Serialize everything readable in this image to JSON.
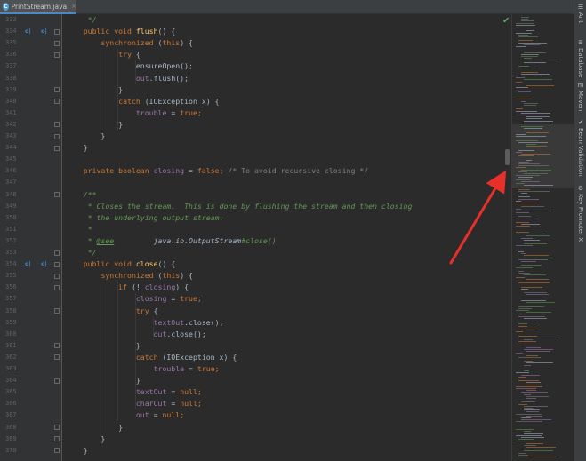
{
  "tab": {
    "icon": "C",
    "label": "PrintStream.java",
    "close": "×"
  },
  "editor": {
    "lines": [
      {
        "n": "333",
        "segs": [
          {
            "t": "     */",
            "c": "dc"
          }
        ]
      },
      {
        "n": "334",
        "m": [
          "o|",
          "o|"
        ],
        "segs": [
          {
            "t": "    ",
            "c": ""
          },
          {
            "t": "public void ",
            "c": "k"
          },
          {
            "t": "flush",
            "c": "f"
          },
          {
            "t": "() {",
            "c": ""
          }
        ]
      },
      {
        "n": "335",
        "segs": [
          {
            "t": "        ",
            "c": ""
          },
          {
            "t": "synchronized ",
            "c": "k"
          },
          {
            "t": "(",
            "c": ""
          },
          {
            "t": "this",
            "c": "k"
          },
          {
            "t": ") {",
            "c": ""
          }
        ]
      },
      {
        "n": "336",
        "segs": [
          {
            "t": "            ",
            "c": ""
          },
          {
            "t": "try ",
            "c": "k"
          },
          {
            "t": "{",
            "c": ""
          }
        ]
      },
      {
        "n": "337",
        "segs": [
          {
            "t": "                ensureOpen();",
            "c": ""
          }
        ]
      },
      {
        "n": "338",
        "segs": [
          {
            "t": "                ",
            "c": ""
          },
          {
            "t": "out",
            "c": "fld"
          },
          {
            "t": ".flush();",
            "c": ""
          }
        ]
      },
      {
        "n": "339",
        "segs": [
          {
            "t": "            }",
            "c": ""
          }
        ]
      },
      {
        "n": "340",
        "segs": [
          {
            "t": "            ",
            "c": ""
          },
          {
            "t": "catch ",
            "c": "k"
          },
          {
            "t": "(IOException x) {",
            "c": ""
          }
        ]
      },
      {
        "n": "341",
        "segs": [
          {
            "t": "                ",
            "c": ""
          },
          {
            "t": "trouble",
            "c": "fld"
          },
          {
            "t": " = ",
            "c": ""
          },
          {
            "t": "true",
            "c": "k"
          },
          {
            "t": ";",
            "c": "k"
          }
        ]
      },
      {
        "n": "342",
        "segs": [
          {
            "t": "            }",
            "c": ""
          }
        ]
      },
      {
        "n": "343",
        "segs": [
          {
            "t": "        }",
            "c": ""
          }
        ]
      },
      {
        "n": "344",
        "segs": [
          {
            "t": "    }",
            "c": ""
          }
        ]
      },
      {
        "n": "345",
        "segs": []
      },
      {
        "n": "346",
        "segs": [
          {
            "t": "    ",
            "c": ""
          },
          {
            "t": "private boolean ",
            "c": "k"
          },
          {
            "t": "closing",
            "c": "fld"
          },
          {
            "t": " = ",
            "c": ""
          },
          {
            "t": "false",
            "c": "k"
          },
          {
            "t": "; ",
            "c": "k"
          },
          {
            "t": "/* To avoid recursive closing */",
            "c": "c"
          }
        ]
      },
      {
        "n": "347",
        "segs": []
      },
      {
        "n": "348",
        "segs": [
          {
            "t": "    /**",
            "c": "dc"
          }
        ]
      },
      {
        "n": "349",
        "segs": [
          {
            "t": "     * Closes the stream.  This is done by flushing the stream and then closing",
            "c": "dc"
          }
        ]
      },
      {
        "n": "350",
        "segs": [
          {
            "t": "     * the underlying output stream.",
            "c": "dc"
          }
        ]
      },
      {
        "n": "351",
        "segs": [
          {
            "t": "     *",
            "c": "dc"
          }
        ]
      },
      {
        "n": "352",
        "segs": [
          {
            "t": "     * ",
            "c": "dc"
          },
          {
            "t": "@see",
            "c": "tg"
          },
          {
            "t": "         java.io.OutputStream",
            "c": "ref"
          },
          {
            "t": "#close()",
            "c": "dc"
          }
        ]
      },
      {
        "n": "353",
        "segs": [
          {
            "t": "     */",
            "c": "dc"
          }
        ]
      },
      {
        "n": "354",
        "m": [
          "o|",
          "o|"
        ],
        "segs": [
          {
            "t": "    ",
            "c": ""
          },
          {
            "t": "public void ",
            "c": "k"
          },
          {
            "t": "close",
            "c": "f"
          },
          {
            "t": "() {",
            "c": ""
          }
        ]
      },
      {
        "n": "355",
        "segs": [
          {
            "t": "        ",
            "c": ""
          },
          {
            "t": "synchronized ",
            "c": "k"
          },
          {
            "t": "(",
            "c": ""
          },
          {
            "t": "this",
            "c": "k"
          },
          {
            "t": ") {",
            "c": ""
          }
        ]
      },
      {
        "n": "356",
        "segs": [
          {
            "t": "            ",
            "c": ""
          },
          {
            "t": "if ",
            "c": "k"
          },
          {
            "t": "(! ",
            "c": ""
          },
          {
            "t": "closing",
            "c": "fld"
          },
          {
            "t": ") {",
            "c": ""
          }
        ]
      },
      {
        "n": "357",
        "segs": [
          {
            "t": "                ",
            "c": ""
          },
          {
            "t": "closing",
            "c": "fld"
          },
          {
            "t": " = ",
            "c": ""
          },
          {
            "t": "true",
            "c": "k"
          },
          {
            "t": ";",
            "c": "k"
          }
        ]
      },
      {
        "n": "358",
        "segs": [
          {
            "t": "                ",
            "c": ""
          },
          {
            "t": "try ",
            "c": "k"
          },
          {
            "t": "{",
            "c": ""
          }
        ]
      },
      {
        "n": "359",
        "segs": [
          {
            "t": "                    ",
            "c": ""
          },
          {
            "t": "textOut",
            "c": "fld"
          },
          {
            "t": ".close();",
            "c": ""
          }
        ]
      },
      {
        "n": "360",
        "segs": [
          {
            "t": "                    ",
            "c": ""
          },
          {
            "t": "out",
            "c": "fld"
          },
          {
            "t": ".close();",
            "c": ""
          }
        ]
      },
      {
        "n": "361",
        "segs": [
          {
            "t": "                }",
            "c": ""
          }
        ]
      },
      {
        "n": "362",
        "segs": [
          {
            "t": "                ",
            "c": ""
          },
          {
            "t": "catch ",
            "c": "k"
          },
          {
            "t": "(IOException x) {",
            "c": ""
          }
        ]
      },
      {
        "n": "363",
        "segs": [
          {
            "t": "                    ",
            "c": ""
          },
          {
            "t": "trouble",
            "c": "fld"
          },
          {
            "t": " = ",
            "c": ""
          },
          {
            "t": "true",
            "c": "k"
          },
          {
            "t": ";",
            "c": "k"
          }
        ]
      },
      {
        "n": "364",
        "segs": [
          {
            "t": "                }",
            "c": ""
          }
        ]
      },
      {
        "n": "365",
        "segs": [
          {
            "t": "                ",
            "c": ""
          },
          {
            "t": "textOut",
            "c": "fld"
          },
          {
            "t": " = ",
            "c": ""
          },
          {
            "t": "null",
            "c": "k"
          },
          {
            "t": ";",
            "c": "k"
          }
        ]
      },
      {
        "n": "366",
        "segs": [
          {
            "t": "                ",
            "c": ""
          },
          {
            "t": "charOut",
            "c": "fld"
          },
          {
            "t": " = ",
            "c": ""
          },
          {
            "t": "null",
            "c": "k"
          },
          {
            "t": ";",
            "c": "k"
          }
        ]
      },
      {
        "n": "367",
        "segs": [
          {
            "t": "                ",
            "c": ""
          },
          {
            "t": "out",
            "c": "fld"
          },
          {
            "t": " = ",
            "c": ""
          },
          {
            "t": "null",
            "c": "k"
          },
          {
            "t": ";",
            "c": "k"
          }
        ]
      },
      {
        "n": "368",
        "segs": [
          {
            "t": "            }",
            "c": ""
          }
        ]
      },
      {
        "n": "369",
        "segs": [
          {
            "t": "        }",
            "c": ""
          }
        ]
      },
      {
        "n": "370",
        "segs": [
          {
            "t": "    }",
            "c": ""
          }
        ]
      }
    ]
  },
  "right_tools": [
    {
      "icon": "☰",
      "icon_name": "ant-icon",
      "label": "Ant"
    },
    {
      "icon": "≣",
      "icon_name": "database-icon",
      "label": "Database"
    },
    {
      "icon": "m",
      "icon_name": "maven-icon",
      "label": "Maven"
    },
    {
      "icon": "✔",
      "icon_name": "bean-validation-icon",
      "label": "Bean Validation"
    },
    {
      "icon": "⚙",
      "icon_name": "key-promoter-icon",
      "label": "Key Promoter X"
    }
  ],
  "colors": {
    "keyword": "#cc7832",
    "method": "#ffc66d",
    "field": "#9876aa",
    "comment": "#808080",
    "doc": "#629755",
    "annotation_arrow": "#e8302a"
  }
}
